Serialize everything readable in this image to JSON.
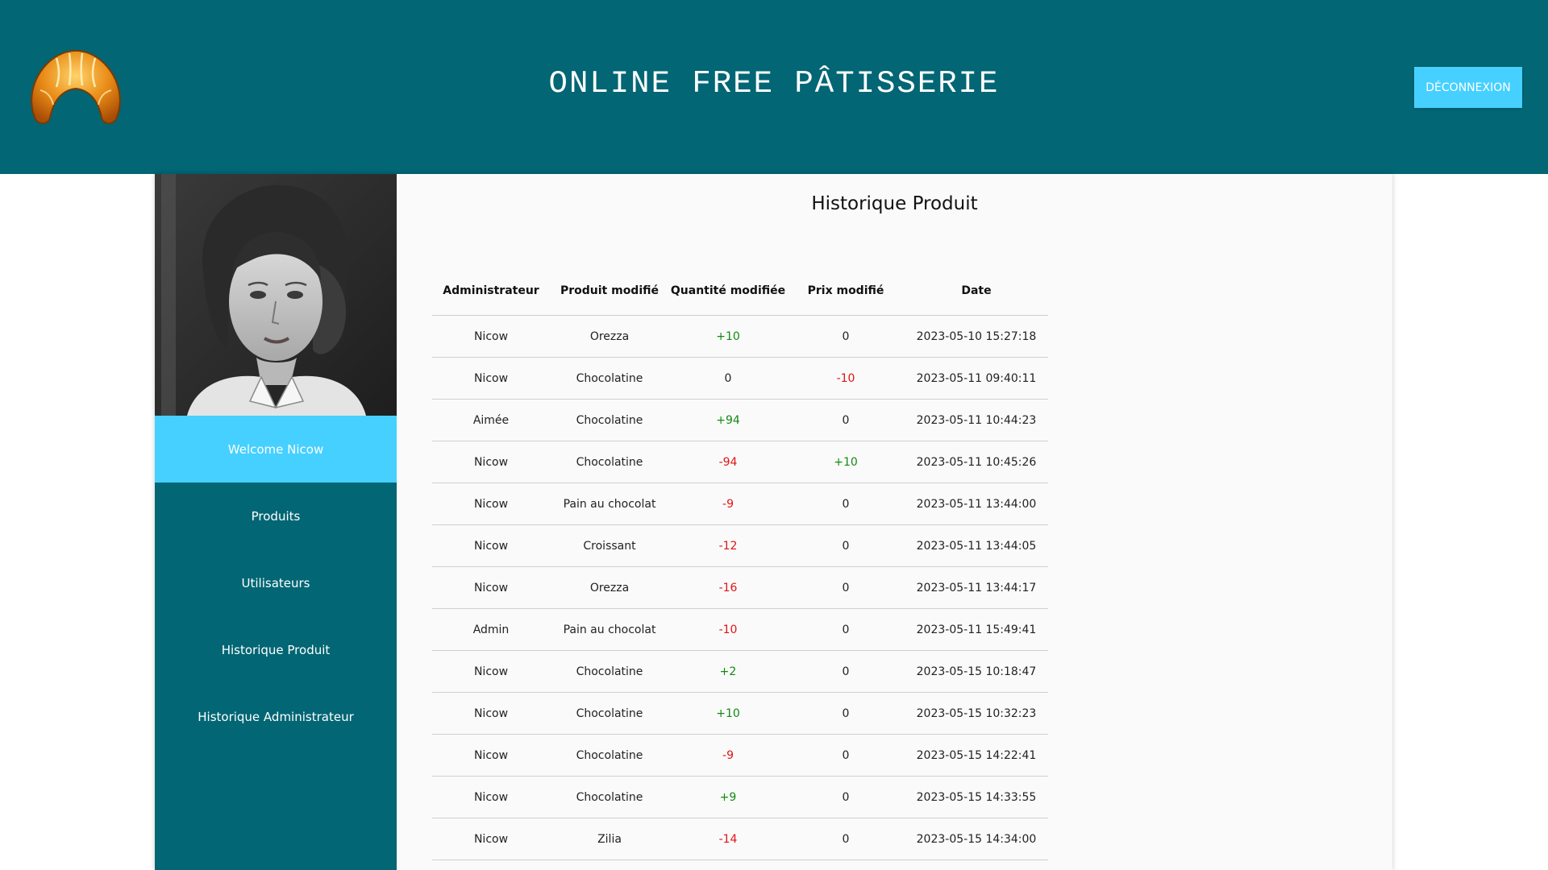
{
  "header": {
    "title": "ONLINE FREE PÂTISSERIE",
    "logout_label": "Déconnexion",
    "logo": "croissant-logo"
  },
  "sidebar": {
    "avatar": "user-portrait",
    "items": [
      {
        "label": "Welcome Nicow",
        "active": true
      },
      {
        "label": "Produits"
      },
      {
        "label": "Utilisateurs"
      },
      {
        "label": "Historique Produit"
      },
      {
        "label": "Historique Administrateur"
      }
    ]
  },
  "main": {
    "title": "Historique Produit",
    "table": {
      "columns": [
        "Administrateur",
        "Produit modifié",
        "Quantité modifiée",
        "Prix modifié",
        "Date"
      ],
      "rows": [
        [
          "Nicow",
          "Orezza",
          "+10",
          "0",
          "2023-05-10 15:27:18"
        ],
        [
          "Nicow",
          "Chocolatine",
          "0",
          "-10",
          "2023-05-11 09:40:11"
        ],
        [
          "Aimée",
          "Chocolatine",
          "+94",
          "0",
          "2023-05-11 10:44:23"
        ],
        [
          "Nicow",
          "Chocolatine",
          "-94",
          "+10",
          "2023-05-11 10:45:26"
        ],
        [
          "Nicow",
          "Pain au chocolat",
          "-9",
          "0",
          "2023-05-11 13:44:00"
        ],
        [
          "Nicow",
          "Croissant",
          "-12",
          "0",
          "2023-05-11 13:44:05"
        ],
        [
          "Nicow",
          "Orezza",
          "-16",
          "0",
          "2023-05-11 13:44:17"
        ],
        [
          "Admin",
          "Pain au chocolat",
          "-10",
          "0",
          "2023-05-11 15:49:41"
        ],
        [
          "Nicow",
          "Chocolatine",
          "+2",
          "0",
          "2023-05-15 10:18:47"
        ],
        [
          "Nicow",
          "Chocolatine",
          "+10",
          "0",
          "2023-05-15 10:32:23"
        ],
        [
          "Nicow",
          "Chocolatine",
          "-9",
          "0",
          "2023-05-15 14:22:41"
        ],
        [
          "Nicow",
          "Chocolatine",
          "+9",
          "0",
          "2023-05-15 14:33:55"
        ],
        [
          "Nicow",
          "Zilia",
          "-14",
          "0",
          "2023-05-15 14:34:00"
        ]
      ]
    }
  },
  "colors": {
    "header_bg": "#026674",
    "accent": "#46d0ff",
    "panel_bg": "#fafafa",
    "positive": "#118a11",
    "negative": "#e01414"
  }
}
